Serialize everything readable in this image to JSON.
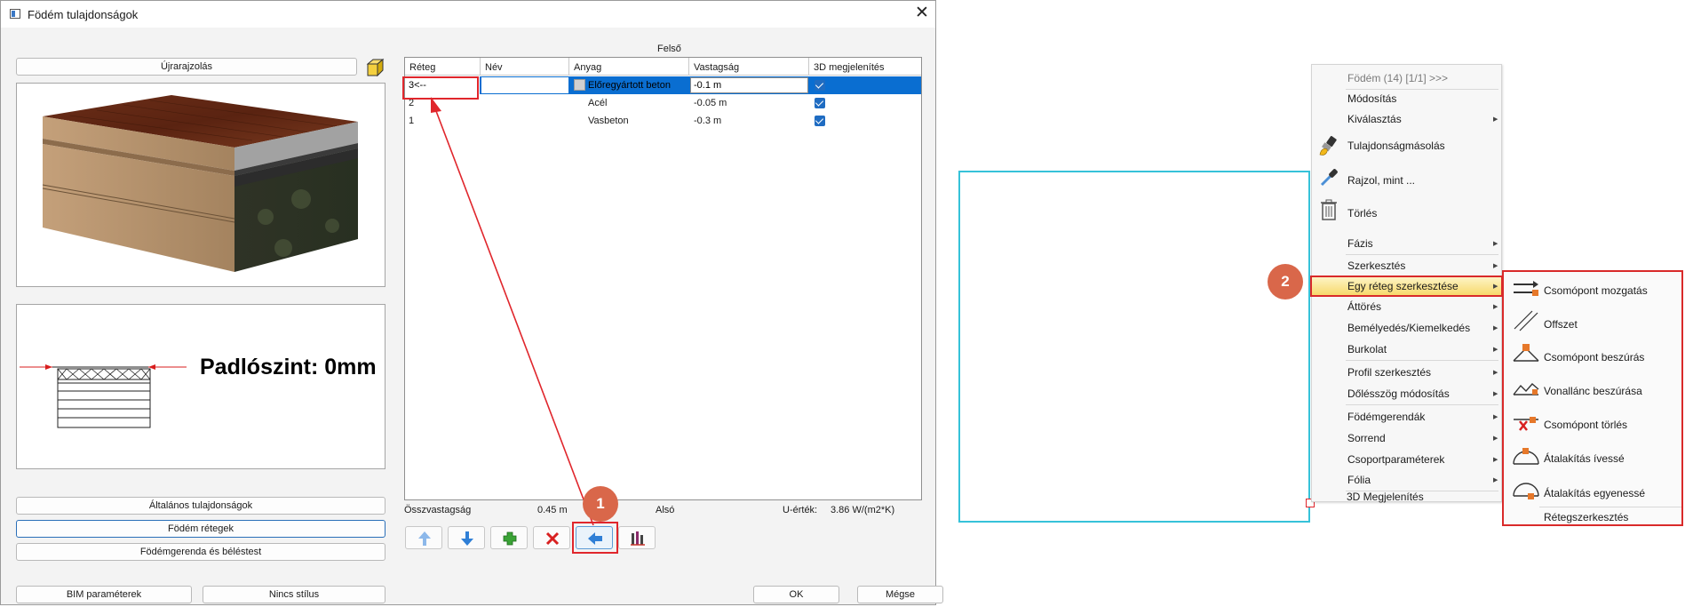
{
  "dialog": {
    "title": "Födém tulajdonságok",
    "redraw_button": "Újrarajzolás",
    "floor_level_label": "Padlószint: 0mm",
    "nav_buttons": [
      "Általános tulajdonságok",
      "Födém rétegek",
      "Födémgerenda és béléstest"
    ],
    "bim_button": "BIM paraméterek",
    "style_button": "Nincs stílus",
    "ok_button": "OK",
    "cancel_button": "Mégse"
  },
  "layers": {
    "top_label": "Felső",
    "bottom_label": "Alsó",
    "columns": [
      "Réteg",
      "Név",
      "Anyag",
      "Vastagság",
      "3D megjelenítés"
    ],
    "rows": [
      {
        "layer": "3<--",
        "name": "",
        "material": "Előregyártott beton",
        "thickness": "-0.1 m",
        "show3d": true,
        "selected": true
      },
      {
        "layer": "2",
        "name": "",
        "material": "Acél",
        "thickness": "-0.05 m",
        "show3d": true,
        "selected": false
      },
      {
        "layer": "1",
        "name": "",
        "material": "Vasbeton",
        "thickness": "-0.3 m",
        "show3d": true,
        "selected": false
      }
    ],
    "total_label": "Összvastagság",
    "total_value": "0.45 m",
    "u_label": "U-érték:",
    "u_value": "3.86 W/(m2*K)",
    "toolbar_icons": [
      "arrow-up-icon",
      "arrow-down-icon",
      "plus-icon",
      "delete-icon",
      "arrow-left-icon",
      "layers-chart-icon"
    ]
  },
  "callouts": {
    "first": "1",
    "second": "2"
  },
  "context_menu": {
    "header": "Födém (14) [1/1] >>>",
    "items": [
      "Módosítás",
      "Kiválasztás",
      "Tulajdonságmásolás",
      "Rajzol, mint ...",
      "Törlés",
      "Fázis",
      "Szerkesztés",
      "Egy réteg szerkesztése",
      "Áttörés",
      "Bemélyedés/Kiemelkedés",
      "Burkolat",
      "Profil szerkesztés",
      "Dőlésszög módosítás",
      "Födémgerendák",
      "Sorrend",
      "Csoportparaméterek",
      "Fólia",
      "3D Megjelenítés"
    ],
    "submenu": [
      "Csomópont mozgatás",
      "Offszet",
      "Csomópont beszúrás",
      "Vonallánc beszúrása",
      "Csomópont törlés",
      "Átalakítás ívessé",
      "Átalakítás egyenessé",
      "Rétegszerkesztés"
    ]
  },
  "colors": {
    "highlight_red": "#e0262c",
    "selection_blue": "#0a6ed1",
    "callout": "#d9674a",
    "slab_outline": "#36c2d9"
  }
}
